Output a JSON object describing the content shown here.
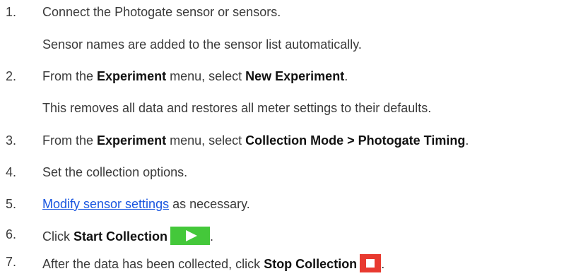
{
  "steps": [
    {
      "num": "1.",
      "text": "Connect the Photogate sensor or sensors.",
      "note": "Sensor names are added to the sensor list automatically."
    },
    {
      "num": "2.",
      "pre": "From the ",
      "menu": "Experiment",
      "mid": " menu, select ",
      "item": "New Experiment",
      "post": ".",
      "note": "This removes all data and restores all meter settings to their defaults."
    },
    {
      "num": "3.",
      "pre": "From the ",
      "menu": "Experiment",
      "mid": " menu, select ",
      "item": "Collection Mode > Photogate Timing",
      "post": "."
    },
    {
      "num": "4.",
      "text": "Set the collection options."
    },
    {
      "num": "5.",
      "link": "Modify sensor settings",
      "post": " as necessary."
    },
    {
      "num": "6.",
      "pre": "Click ",
      "action": "Start Collection",
      "icon": "play-icon",
      "post": "."
    },
    {
      "num": "7.",
      "pre": "After the data has been collected, click ",
      "action": "Stop Collection",
      "icon": "stop-icon",
      "post": "."
    }
  ],
  "colors": {
    "text": "#3a3a3a",
    "link": "#1a56e0",
    "play": "#44c83a",
    "stop": "#e83a30"
  }
}
